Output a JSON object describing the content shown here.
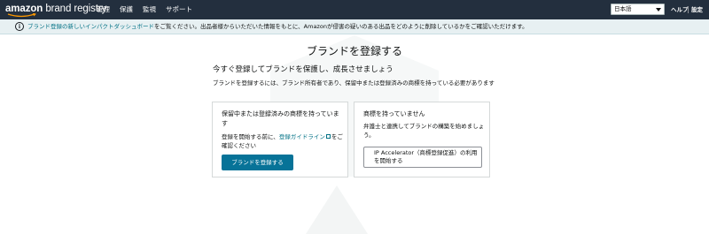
{
  "header": {
    "logo_brand": "amazon",
    "logo_product": "brand registry",
    "nav": [
      "管理",
      "保護",
      "監視",
      "サポート"
    ],
    "language_selected": "日本語",
    "help_label": "ヘルプ",
    "settings_label": "設定"
  },
  "banner": {
    "link_text": "ブランド登録の新しいインパクトダッシュボード",
    "text": "をご覧ください。出品者様からいただいた情報をもとに、Amazonが侵害の疑いのある出品をどのように削除しているかをご確認いただけます。"
  },
  "main": {
    "title": "ブランドを登録する",
    "subtitle": "今すぐ登録してブランドを保護し、成長させましょう",
    "description": "ブランドを登録するには、ブランド所有者であり、保留中または登録済みの商標を持っている必要があります"
  },
  "cards": {
    "left": {
      "title": "保留中または登録済みの商標を持っています",
      "body_prefix": "登録を開始する前に、",
      "body_link": "登録ガイドライン",
      "body_suffix": "をご確認ください",
      "button": "ブランドを登録する"
    },
    "right": {
      "title": "商標を持っていません",
      "body": "弁護士と連携してブランドの構築を始めましょう。",
      "button": "IP Accelerator（商標登録促進）の利用を開始する"
    }
  },
  "colors": {
    "topbar": "#232f3e",
    "banner_bg": "#e7f0f2",
    "link": "#007185",
    "primary_button": "#077398"
  }
}
